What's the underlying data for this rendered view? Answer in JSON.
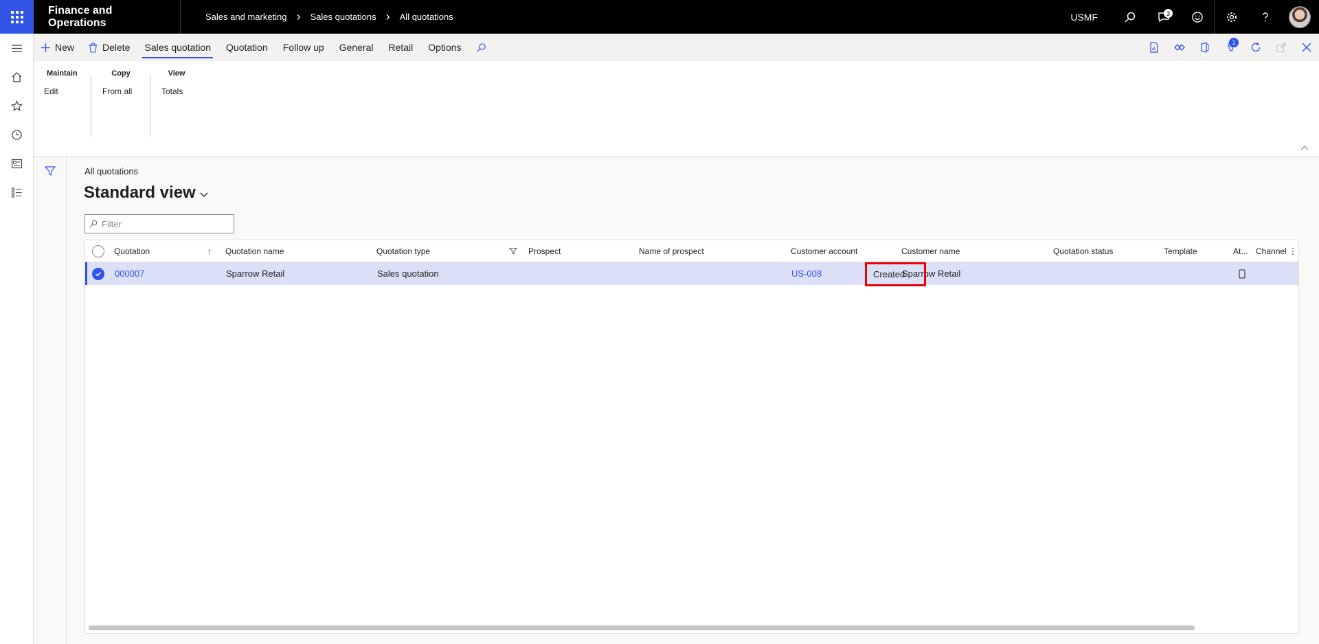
{
  "topbar": {
    "app_title": "Finance and Operations",
    "breadcrumbs": [
      "Sales and marketing",
      "Sales quotations",
      "All quotations"
    ],
    "company": "USMF",
    "notification_count": "3"
  },
  "action_pane": {
    "new_label": "New",
    "delete_label": "Delete",
    "tabs": [
      "Sales quotation",
      "Quotation",
      "Follow up",
      "General",
      "Retail",
      "Options"
    ],
    "active_tab": "Sales quotation",
    "attachment_badge": "1"
  },
  "ribbon": {
    "groups": [
      {
        "title": "Maintain",
        "items": [
          "Edit"
        ]
      },
      {
        "title": "Copy",
        "items": [
          "From all"
        ]
      },
      {
        "title": "View",
        "items": [
          "Totals"
        ]
      }
    ]
  },
  "page": {
    "breadcrumb": "All quotations",
    "view_name": "Standard view",
    "filter_placeholder": "Filter"
  },
  "grid": {
    "columns": [
      "Quotation",
      "Quotation name",
      "Quotation type",
      "Prospect",
      "Name of prospect",
      "Customer account",
      "Customer name",
      "Quotation status",
      "Template",
      "At...",
      "Channel"
    ],
    "rows": [
      {
        "quotation": "000007",
        "quotation_name": "Sparrow Retail",
        "quotation_type": "Sales quotation",
        "prospect": "",
        "name_of_prospect": "",
        "customer_account": "US-008",
        "customer_name": "Sparrow Retail",
        "quotation_status": "Created",
        "template": "",
        "attachment": "",
        "channel": ""
      }
    ]
  },
  "colors": {
    "accent": "#2f54e6",
    "highlight": "#ee0000",
    "selected_row": "#dbe0f7"
  }
}
